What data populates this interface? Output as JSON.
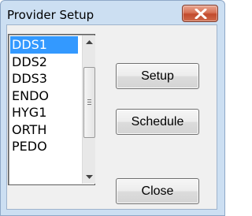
{
  "window": {
    "title": "Provider Setup",
    "close_icon": "close-icon"
  },
  "provider_list": {
    "items": [
      "DDS1",
      "DDS2",
      "DDS3",
      "ENDO",
      "HYG1",
      "ORTH",
      "PEDO"
    ],
    "selected": "DDS1"
  },
  "buttons": {
    "setup": "Setup",
    "schedule": "Schedule",
    "close": "Close"
  },
  "colors": {
    "selection": "#3399ff",
    "close_button": "#c24b2d"
  }
}
